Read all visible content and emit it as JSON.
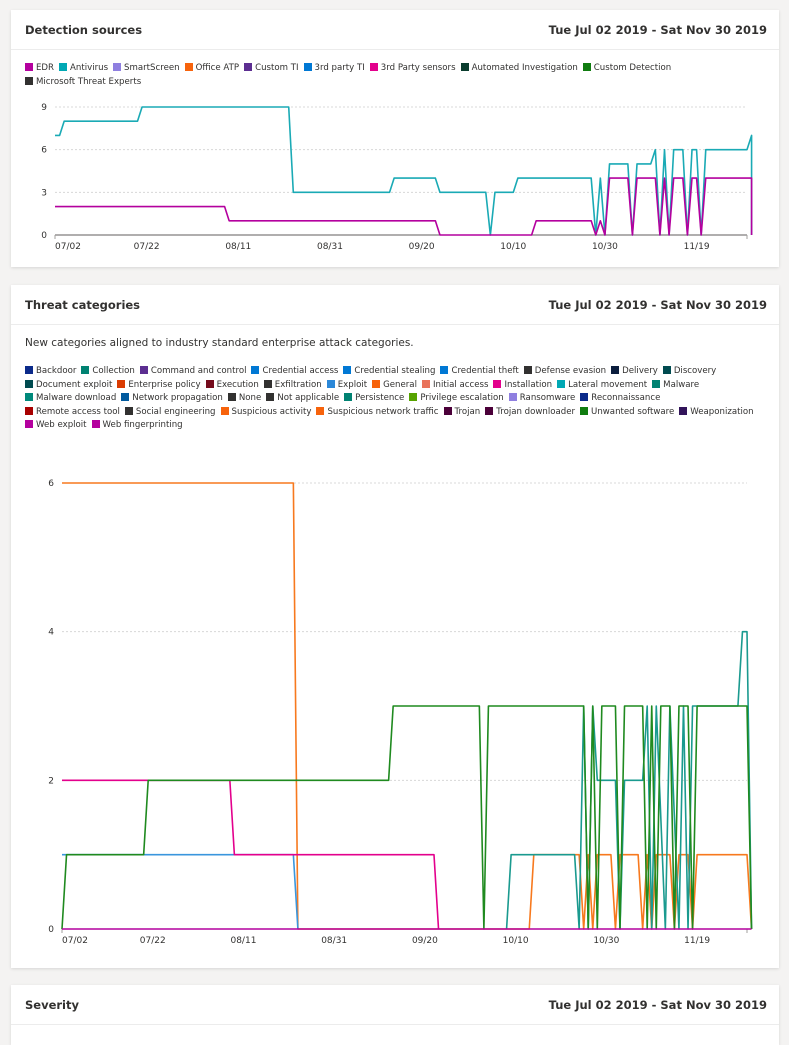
{
  "date_range": "Tue Jul 02 2019 - Sat Nov 30 2019",
  "cards": {
    "detection": {
      "title": "Detection sources"
    },
    "threat": {
      "title": "Threat categories",
      "subtitle": "New categories aligned to industry standard enterprise attack categories."
    },
    "severity": {
      "title": "Severity"
    }
  },
  "chart_data": [
    {
      "type": "line",
      "title": "Detection sources",
      "x_unit": "days since 07/02",
      "xlim": [
        0,
        151
      ],
      "ylim": [
        0,
        9
      ],
      "yticks": [
        0,
        3,
        6,
        9
      ],
      "xticks": [
        {
          "d": 0,
          "label": "07/02"
        },
        {
          "d": 20,
          "label": "07/22"
        },
        {
          "d": 40,
          "label": "08/11"
        },
        {
          "d": 60,
          "label": "08/31"
        },
        {
          "d": 80,
          "label": "09/20"
        },
        {
          "d": 100,
          "label": "10/10"
        },
        {
          "d": 120,
          "label": "10/30"
        },
        {
          "d": 140,
          "label": "11/19"
        }
      ],
      "grid": true,
      "legend": [
        {
          "name": "EDR",
          "color": "#b4009e"
        },
        {
          "name": "Antivirus",
          "color": "#00a8b4"
        },
        {
          "name": "SmartScreen",
          "color": "#8f7fe0"
        },
        {
          "name": "Office ATP",
          "color": "#f7630c"
        },
        {
          "name": "Custom TI",
          "color": "#5c2e91"
        },
        {
          "name": "3rd party TI",
          "color": "#0078d4"
        },
        {
          "name": "3rd Party sensors",
          "color": "#e3008c"
        },
        {
          "name": "Automated Investigation",
          "color": "#0b3d2e"
        },
        {
          "name": "Custom Detection",
          "color": "#107c10"
        },
        {
          "name": "Microsoft Threat Experts",
          "color": "#323130"
        }
      ],
      "series": [
        {
          "name": "Antivirus",
          "color": "#1aaab5",
          "points": [
            [
              0,
              7
            ],
            [
              1,
              7
            ],
            [
              2,
              8
            ],
            [
              18,
              8
            ],
            [
              19,
              9
            ],
            [
              51,
              9
            ],
            [
              52,
              3
            ],
            [
              73,
              3
            ],
            [
              74,
              4
            ],
            [
              83,
              4
            ],
            [
              84,
              3
            ],
            [
              94,
              3
            ],
            [
              95,
              0
            ],
            [
              96,
              3
            ],
            [
              100,
              3
            ],
            [
              101,
              4
            ],
            [
              117,
              4
            ],
            [
              118,
              0
            ],
            [
              119,
              4
            ],
            [
              120,
              0
            ],
            [
              121,
              5
            ],
            [
              125,
              5
            ],
            [
              126,
              0
            ],
            [
              127,
              5
            ],
            [
              130,
              5
            ],
            [
              131,
              6
            ],
            [
              132,
              0
            ],
            [
              133,
              6
            ],
            [
              134,
              0
            ],
            [
              135,
              6
            ],
            [
              137,
              6
            ],
            [
              138,
              0
            ],
            [
              139,
              6
            ],
            [
              140,
              6
            ],
            [
              141,
              0
            ],
            [
              142,
              6
            ],
            [
              151,
              6
            ],
            [
              152,
              7
            ],
            [
              153,
              0
            ]
          ]
        },
        {
          "name": "EDR",
          "color": "#b4009e",
          "points": [
            [
              0,
              2
            ],
            [
              37,
              2
            ],
            [
              38,
              1
            ],
            [
              83,
              1
            ],
            [
              84,
              0
            ],
            [
              104,
              0
            ],
            [
              105,
              1
            ],
            [
              117,
              1
            ],
            [
              118,
              0
            ],
            [
              119,
              1
            ],
            [
              120,
              0
            ],
            [
              121,
              4
            ],
            [
              125,
              4
            ],
            [
              126,
              0
            ],
            [
              127,
              4
            ],
            [
              131,
              4
            ],
            [
              132,
              0
            ],
            [
              133,
              4
            ],
            [
              134,
              0
            ],
            [
              135,
              4
            ],
            [
              137,
              4
            ],
            [
              138,
              0
            ],
            [
              139,
              4
            ],
            [
              140,
              4
            ],
            [
              141,
              0
            ],
            [
              142,
              4
            ],
            [
              152,
              4
            ],
            [
              153,
              0
            ]
          ]
        }
      ]
    },
    {
      "type": "line",
      "title": "Threat categories",
      "x_unit": "days since 07/02",
      "xlim": [
        0,
        151
      ],
      "ylim": [
        0,
        6
      ],
      "yticks": [
        0,
        2,
        4,
        6
      ],
      "xticks": [
        {
          "d": 0,
          "label": "07/02"
        },
        {
          "d": 20,
          "label": "07/22"
        },
        {
          "d": 40,
          "label": "08/11"
        },
        {
          "d": 60,
          "label": "08/31"
        },
        {
          "d": 80,
          "label": "09/20"
        },
        {
          "d": 100,
          "label": "10/10"
        },
        {
          "d": 120,
          "label": "10/30"
        },
        {
          "d": 140,
          "label": "11/19"
        }
      ],
      "grid": true,
      "legend": [
        {
          "name": "Backdoor",
          "color": "#0b2a8a"
        },
        {
          "name": "Collection",
          "color": "#008272"
        },
        {
          "name": "Command and control",
          "color": "#5c2e91"
        },
        {
          "name": "Credential access",
          "color": "#0078d4"
        },
        {
          "name": "Credential stealing",
          "color": "#0078d4"
        },
        {
          "name": "Credential theft",
          "color": "#0078d4"
        },
        {
          "name": "Defense evasion",
          "color": "#323130"
        },
        {
          "name": "Delivery",
          "color": "#0b1e3d"
        },
        {
          "name": "Discovery",
          "color": "#004b50"
        },
        {
          "name": "Document exploit",
          "color": "#004b50"
        },
        {
          "name": "Enterprise policy",
          "color": "#da3b01"
        },
        {
          "name": "Execution",
          "color": "#750b1c"
        },
        {
          "name": "Exfiltration",
          "color": "#323130"
        },
        {
          "name": "Exploit",
          "color": "#2b88d8"
        },
        {
          "name": "General",
          "color": "#f7630c"
        },
        {
          "name": "Initial access",
          "color": "#e9735b"
        },
        {
          "name": "Installation",
          "color": "#e3008c"
        },
        {
          "name": "Lateral movement",
          "color": "#00a8b4"
        },
        {
          "name": "Malware",
          "color": "#008272"
        },
        {
          "name": "Malware download",
          "color": "#00897b"
        },
        {
          "name": "Network propagation",
          "color": "#005a9e"
        },
        {
          "name": "None",
          "color": "#323130"
        },
        {
          "name": "Not applicable",
          "color": "#323130"
        },
        {
          "name": "Persistence",
          "color": "#008272"
        },
        {
          "name": "Privilege escalation",
          "color": "#57a300"
        },
        {
          "name": "Ransomware",
          "color": "#8f7fe0"
        },
        {
          "name": "Reconnaissance",
          "color": "#0b2a8a"
        },
        {
          "name": "Remote access tool",
          "color": "#a80000"
        },
        {
          "name": "Social engineering",
          "color": "#323130"
        },
        {
          "name": "Suspicious activity",
          "color": "#f7630c"
        },
        {
          "name": "Suspicious network traffic",
          "color": "#f7630c"
        },
        {
          "name": "Trojan",
          "color": "#4b0039"
        },
        {
          "name": "Trojan downloader",
          "color": "#4b0039"
        },
        {
          "name": "Unwanted software",
          "color": "#107c10"
        },
        {
          "name": "Weaponization",
          "color": "#32145a"
        },
        {
          "name": "Web exploit",
          "color": "#b4009e"
        },
        {
          "name": "Web fingerprinting",
          "color": "#b4009e"
        }
      ],
      "series": [
        {
          "name": "Suspicious activity",
          "color": "#f7791e",
          "points": [
            [
              0,
              6
            ],
            [
              51,
              6
            ],
            [
              52,
              0
            ],
            [
              103,
              0
            ],
            [
              104,
              1
            ],
            [
              114,
              1
            ],
            [
              115,
              0
            ],
            [
              116,
              1
            ],
            [
              117,
              0
            ],
            [
              118,
              1
            ],
            [
              121,
              1
            ],
            [
              122,
              0
            ],
            [
              123,
              1
            ],
            [
              127,
              1
            ],
            [
              128,
              0
            ],
            [
              129,
              1
            ],
            [
              130,
              0
            ],
            [
              131,
              1
            ],
            [
              134,
              1
            ],
            [
              135,
              0
            ],
            [
              136,
              1
            ],
            [
              138,
              1
            ],
            [
              139,
              0
            ],
            [
              140,
              1
            ],
            [
              151,
              1
            ],
            [
              152,
              0
            ]
          ]
        },
        {
          "name": "Credential access",
          "color": "#3a96dd",
          "points": [
            [
              0,
              1
            ],
            [
              51,
              1
            ],
            [
              52,
              0
            ]
          ]
        },
        {
          "name": "Installation",
          "color": "#e3008c",
          "points": [
            [
              0,
              2
            ],
            [
              37,
              2
            ],
            [
              38,
              1
            ],
            [
              82,
              1
            ],
            [
              83,
              0
            ]
          ]
        },
        {
          "name": "Malware",
          "color": "#1a9a8f",
          "points": [
            [
              98,
              0
            ],
            [
              99,
              1
            ],
            [
              104,
              1
            ],
            [
              113,
              1
            ],
            [
              114,
              0
            ],
            [
              115,
              3
            ],
            [
              116,
              0
            ],
            [
              117,
              3
            ],
            [
              118,
              2
            ],
            [
              122,
              2
            ],
            [
              123,
              0
            ],
            [
              124,
              2
            ],
            [
              128,
              2
            ],
            [
              129,
              3
            ],
            [
              130,
              0
            ],
            [
              131,
              3
            ],
            [
              133,
              0
            ],
            [
              134,
              3
            ],
            [
              136,
              0
            ],
            [
              137,
              3
            ],
            [
              138,
              0
            ],
            [
              139,
              3
            ],
            [
              149,
              3
            ],
            [
              150,
              4
            ],
            [
              151,
              4
            ],
            [
              152,
              0
            ]
          ]
        },
        {
          "name": "Unwanted software",
          "color": "#1f8a1f",
          "points": [
            [
              0,
              0
            ],
            [
              1,
              1
            ],
            [
              18,
              1
            ],
            [
              19,
              2
            ],
            [
              72,
              2
            ],
            [
              73,
              3
            ],
            [
              92,
              3
            ],
            [
              93,
              0
            ],
            [
              94,
              3
            ],
            [
              115,
              3
            ],
            [
              116,
              0
            ],
            [
              117,
              3
            ],
            [
              118,
              0
            ],
            [
              119,
              3
            ],
            [
              122,
              3
            ],
            [
              123,
              0
            ],
            [
              124,
              3
            ],
            [
              128,
              3
            ],
            [
              129,
              0
            ],
            [
              130,
              3
            ],
            [
              131,
              0
            ],
            [
              132,
              3
            ],
            [
              134,
              3
            ],
            [
              135,
              0
            ],
            [
              136,
              3
            ],
            [
              138,
              3
            ],
            [
              139,
              0
            ],
            [
              140,
              3
            ],
            [
              151,
              3
            ],
            [
              152,
              0
            ]
          ]
        },
        {
          "name": "Web exploit",
          "color": "#b4009e",
          "points": [
            [
              0,
              0
            ],
            [
              152,
              0
            ]
          ]
        }
      ]
    }
  ]
}
